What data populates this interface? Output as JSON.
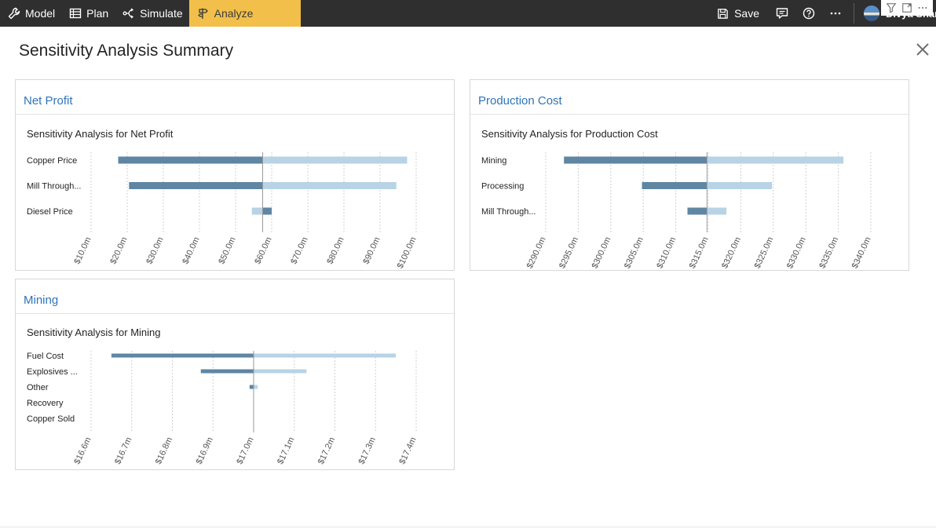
{
  "toolbar": {
    "model_label": "Model",
    "plan_label": "Plan",
    "simulate_label": "Simulate",
    "analyze_label": "Analyze",
    "save_label": "Save",
    "user_name": "Divya Shan..."
  },
  "page": {
    "title": "Sensitivity Analysis Summary"
  },
  "colors": {
    "accent_tab": "#f2c04a",
    "card_title": "#2f74b8",
    "bar_dark": "#5f86a3",
    "bar_light": "#b8d3e6"
  },
  "cards": [
    {
      "header": "Net Profit",
      "chart_title": "Sensitivity Analysis for Net Profit"
    },
    {
      "header": "Production Cost",
      "chart_title": "Sensitivity Analysis for Production Cost"
    },
    {
      "header": "Mining",
      "chart_title": "Sensitivity Analysis for Mining"
    }
  ],
  "chart_data": [
    {
      "type": "bar",
      "title": "Sensitivity Analysis for Net Profit",
      "orientation": "horizontal-tornado",
      "categories": [
        "Copper Price",
        "Mill Through...",
        "Diesel Price"
      ],
      "baseline": 57.5,
      "series": [
        {
          "values_low": [
            17.5,
            20.5,
            60.0
          ]
        },
        {
          "values_high": [
            97.5,
            94.5,
            54.5
          ]
        }
      ],
      "xlim": [
        10,
        100
      ],
      "ticks": [
        10,
        20,
        30,
        40,
        50,
        60,
        70,
        80,
        90,
        100
      ],
      "tick_labels": [
        "$10.0m",
        "$20.0m",
        "$30.0m",
        "$40.0m",
        "$50.0m",
        "$60.0m",
        "$70.0m",
        "$80.0m",
        "$90.0m",
        "$100.0m"
      ],
      "grid": true
    },
    {
      "type": "bar",
      "title": "Sensitivity Analysis for Production Cost",
      "orientation": "horizontal-tornado",
      "categories": [
        "Mining",
        "Processing",
        "Mill Through..."
      ],
      "baseline": 314.8,
      "series": [
        {
          "values_low": [
            292.8,
            304.8,
            311.8
          ]
        },
        {
          "values_high": [
            335.8,
            324.8,
            317.8
          ]
        }
      ],
      "xlim": [
        290,
        340
      ],
      "ticks": [
        290,
        295,
        300,
        305,
        310,
        315,
        320,
        325,
        330,
        335,
        340
      ],
      "tick_labels": [
        "$290.0m",
        "$295.0m",
        "$300.0m",
        "$305.0m",
        "$310.0m",
        "$315.0m",
        "$320.0m",
        "$325.0m",
        "$330.0m",
        "$335.0m",
        "$340.0m"
      ],
      "grid": true
    },
    {
      "type": "bar",
      "title": "Sensitivity Analysis for Mining",
      "orientation": "horizontal-tornado",
      "categories": [
        "Fuel Cost",
        "Explosives ...",
        "Other",
        "Recovery",
        "Copper Sold"
      ],
      "baseline": 17.0,
      "series": [
        {
          "values_low": [
            16.65,
            16.87,
            16.99,
            null,
            null
          ]
        },
        {
          "values_high": [
            17.35,
            17.13,
            17.01,
            null,
            null
          ]
        }
      ],
      "xlim": [
        16.6,
        17.4
      ],
      "ticks": [
        16.6,
        16.7,
        16.8,
        16.9,
        17.0,
        17.1,
        17.2,
        17.3,
        17.4
      ],
      "tick_labels": [
        "$16.6m",
        "$16.7m",
        "$16.8m",
        "$16.9m",
        "$17.0m",
        "$17.1m",
        "$17.2m",
        "$17.3m",
        "$17.4m"
      ],
      "grid": true
    }
  ]
}
